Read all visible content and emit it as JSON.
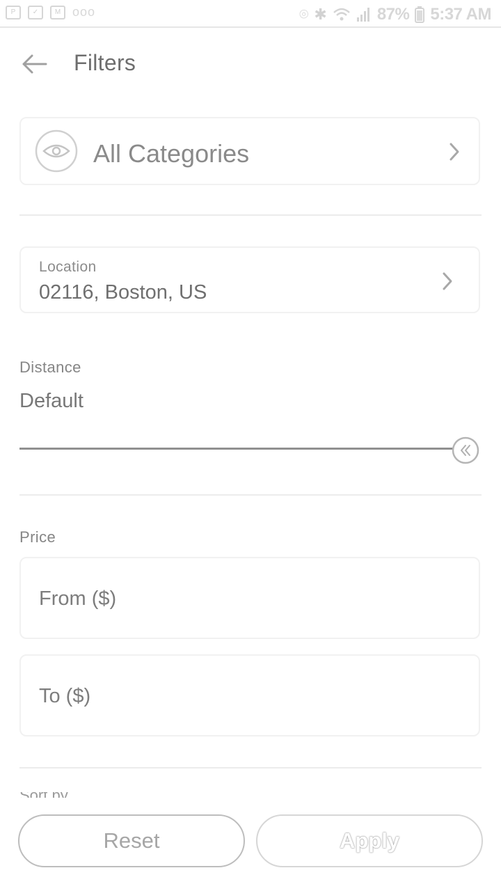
{
  "status_bar": {
    "left_icons": [
      "photo-icon",
      "task-icon",
      "gmail-icon",
      "more-dots-icon"
    ],
    "left_box_1": "P",
    "more_dots": "ooo",
    "right_icons": [
      "location-icon",
      "bluetooth-icon",
      "wifi-icon",
      "signal-icon",
      "battery-icon"
    ],
    "battery": "87%",
    "time": "5:37 AM"
  },
  "header": {
    "title": "Filters",
    "back_icon": "arrow-left-icon"
  },
  "category": {
    "label": "All Categories",
    "icon": "eye-icon"
  },
  "location": {
    "label": "Location",
    "value": "02116, Boston, US"
  },
  "distance": {
    "label": "Distance",
    "value": "Default",
    "level": 1.0
  },
  "price": {
    "label": "Price",
    "from_placeholder": "From ($)",
    "to_placeholder": "To ($)"
  },
  "next_section": {
    "label_partial": "Sort by"
  },
  "actions": {
    "reset_label": "Reset",
    "apply_label": "Apply"
  },
  "colors": {
    "text_primary": "#6e6e6e",
    "text_secondary": "#858585",
    "border": "#f1f1f1",
    "divider": "#ececec",
    "button_border": "#bdbdbd"
  }
}
